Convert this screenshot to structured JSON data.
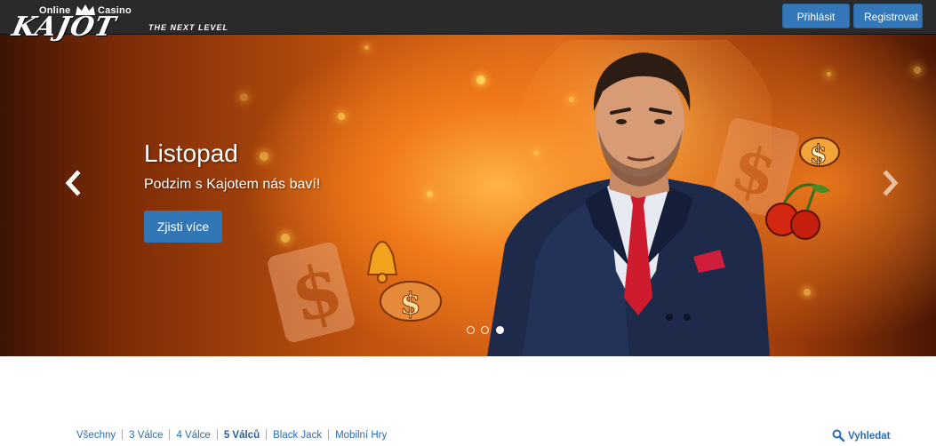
{
  "header": {
    "logo": {
      "online": "Online",
      "casino": "Casino",
      "brand": "KAJOT"
    },
    "tagline": "THE NEXT LEVEL",
    "login_label": "Přihlásit se",
    "register_label": "Registrovat"
  },
  "carousel": {
    "title": "Listopad",
    "subtitle": "Podzim s Kajotem nás baví!",
    "cta_label": "Zjisti více",
    "slides_total": 3,
    "active_slide": 3,
    "prev_icon": "chevron-left-icon",
    "next_icon": "chevron-right-icon"
  },
  "categories": {
    "items": [
      {
        "label": "Všechny",
        "active": false
      },
      {
        "label": "3 Válce",
        "active": false
      },
      {
        "label": "4 Válce",
        "active": false
      },
      {
        "label": "5 Válců",
        "active": true
      },
      {
        "label": "Black Jack",
        "active": false
      },
      {
        "label": "Mobilní Hry",
        "active": false
      }
    ],
    "search_label": "Vyhledat",
    "search_icon": "search-icon"
  },
  "colors": {
    "topbar": "#2a2a2a",
    "button": "#3377b8",
    "link": "#2b6cb3",
    "hero_orange": "#d7651a"
  }
}
